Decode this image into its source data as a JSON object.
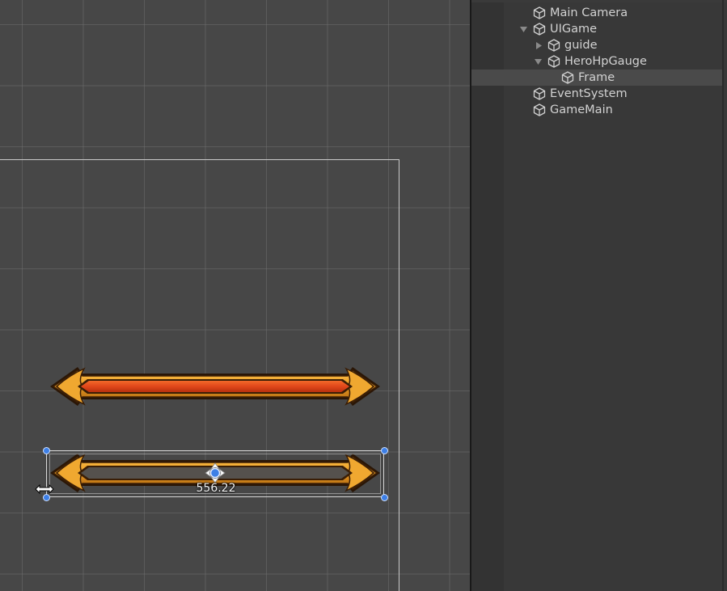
{
  "scene": {
    "size_readout": "556.22",
    "gauges": [
      {
        "name": "hp-gauge-filled",
        "fill": 1.0,
        "fill_color": "#e0471a",
        "frame_color": "#e99a24"
      },
      {
        "name": "hp-gauge-frame-selected",
        "fill": 0.0,
        "frame_color": "#e99a24"
      }
    ],
    "selection_color": "#3d7fe6"
  },
  "hierarchy": {
    "items": [
      {
        "label": "Main Camera",
        "icon": "gameobject-cube-icon",
        "expander": "none"
      },
      {
        "label": "UIGame",
        "icon": "gameobject-cube-icon",
        "expander": "expanded"
      },
      {
        "label": "guide",
        "icon": "gameobject-cube-icon",
        "expander": "collapsed"
      },
      {
        "label": "HeroHpGauge",
        "icon": "gameobject-cube-icon",
        "expander": "expanded"
      },
      {
        "label": "Frame",
        "icon": "gameobject-cube-icon",
        "expander": "none",
        "selected": true
      },
      {
        "label": "EventSystem",
        "icon": "gameobject-cube-icon",
        "expander": "none"
      },
      {
        "label": "GameMain",
        "icon": "gameobject-cube-icon",
        "expander": "none"
      }
    ]
  }
}
